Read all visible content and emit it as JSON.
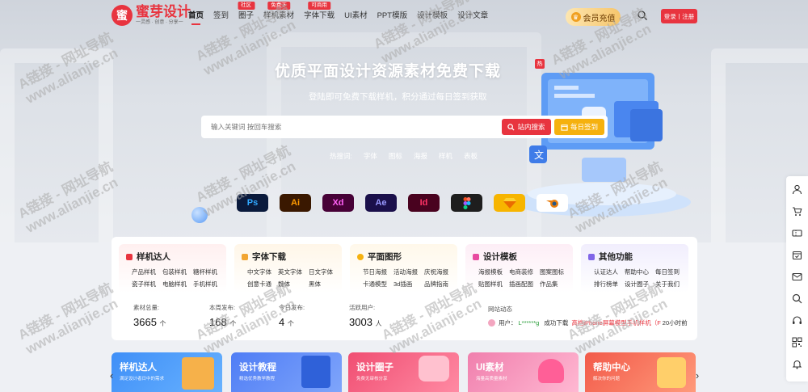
{
  "brand": {
    "name": "蜜芽设计",
    "slogan": "一灵感 · 创意 · 分享一",
    "mark": "蜜"
  },
  "nav": [
    {
      "label": "首页",
      "active": true,
      "badge": ""
    },
    {
      "label": "签到",
      "active": false,
      "badge": ""
    },
    {
      "label": "圈子",
      "active": false,
      "badge": "社区"
    },
    {
      "label": "样机素材",
      "active": false,
      "badge": "免费下"
    },
    {
      "label": "字体下载",
      "active": false,
      "badge": "可商用"
    },
    {
      "label": "UI素材",
      "active": false,
      "badge": ""
    },
    {
      "label": "PPT模版",
      "active": false,
      "badge": ""
    },
    {
      "label": "设计模板",
      "active": false,
      "badge": ""
    },
    {
      "label": "设计文章",
      "active": false,
      "badge": ""
    }
  ],
  "header": {
    "vip_label": "会员充值",
    "login_label": "登录丨注册"
  },
  "hero": {
    "title": "优质平面设计资源素材免费下载",
    "hot_tag": "热",
    "subtitle": "登陆即可免费下载样机，积分通过每日签到获取",
    "search_placeholder": "输入关键词 按回车搜索",
    "site_search_label": "站内搜索",
    "sign_label": "每日签到",
    "hot_label": "热搜词:",
    "hot_words": [
      "字体",
      "图标",
      "海报",
      "样机",
      "表板"
    ]
  },
  "apps": [
    {
      "label": "Ps",
      "bg": "#0a1a3c",
      "fg": "#31a8ff"
    },
    {
      "label": "Ai",
      "bg": "#3a1800",
      "fg": "#ff9a00"
    },
    {
      "label": "Xd",
      "bg": "#470137",
      "fg": "#ff61f6"
    },
    {
      "label": "Ae",
      "bg": "#1a0f4a",
      "fg": "#9999ff"
    },
    {
      "label": "Id",
      "bg": "#49021f",
      "fg": "#ff3366"
    },
    {
      "label": "figma-icon",
      "bg": "#1e1e1e",
      "fg": "#ffffff"
    },
    {
      "label": "sketch-icon",
      "bg": "#f7b500",
      "fg": "#ffffff"
    },
    {
      "label": "blender-icon",
      "bg": "#ffffff",
      "fg": "#e87d0d"
    }
  ],
  "categories": [
    {
      "title": "样机达人",
      "color": "#e8343f",
      "bg": "#fff6f6",
      "items": [
        "产品样机",
        "包装样机",
        "糖杯样机",
        "瓷子样机",
        "电脑样机",
        "手机样机"
      ]
    },
    {
      "title": "字体下载",
      "color": "#f2a531",
      "bg": "#fffaf2",
      "items": [
        "中文字体",
        "英文字体",
        "日文字体",
        "创意卡通",
        "魏体",
        "黑体"
      ]
    },
    {
      "title": "平面图形",
      "color": "#f5b10f",
      "bg": "#fffbf2",
      "items": [
        "节日海报",
        "活动海报",
        "庆祝海报",
        "卡通模型",
        "3d插画",
        "品牌指南"
      ]
    },
    {
      "title": "设计模板",
      "color": "#e84aa0",
      "bg": "#fdf5fa",
      "items": [
        "海报模板",
        "电商装修",
        "图案图标",
        "贴图样机",
        "插画配图",
        "作品集"
      ]
    },
    {
      "title": "其他功能",
      "color": "#8066e8",
      "bg": "#f6f4fe",
      "items": [
        "认证达人",
        "帮助中心",
        "每日签到",
        "排行榜单",
        "设计圈子",
        "关于我们"
      ]
    }
  ],
  "stats": [
    {
      "label": "素材总量:",
      "value": "3665",
      "unit": "个"
    },
    {
      "label": "本周发布:",
      "value": "168",
      "unit": "个"
    },
    {
      "label": "今日发布:",
      "value": "4",
      "unit": "个"
    },
    {
      "label": "活跃用户:",
      "value": "3003",
      "unit": "人"
    }
  ],
  "dynamic": {
    "label": "网站动态",
    "user_prefix": "用户：",
    "user": "L******g",
    "action": "成功下载",
    "item": "高档iPhone屏幕模型手机样机（F",
    "time": "20小时前"
  },
  "banners": [
    {
      "title": "样机达人",
      "sub": "满足设计者日中的需求",
      "bg": "#3e8cf6"
    },
    {
      "title": "设计教程",
      "sub": "精选优秀教学教程",
      "bg": "#4f7df5"
    },
    {
      "title": "设计圈子",
      "sub": "免费无审核分享",
      "bg": "#f25c78"
    },
    {
      "title": "UI素材",
      "sub": "海量高质量素材",
      "bg": "#f08fb6"
    },
    {
      "title": "帮助中心",
      "sub": "解决你的问题",
      "bg": "#f25a4a"
    }
  ],
  "watermark": {
    "line1": "A链接 - 网址导航",
    "line2": "www.alianjie.cn"
  },
  "colors": {
    "accent": "#e8343f",
    "gold": "#f5b10f"
  }
}
